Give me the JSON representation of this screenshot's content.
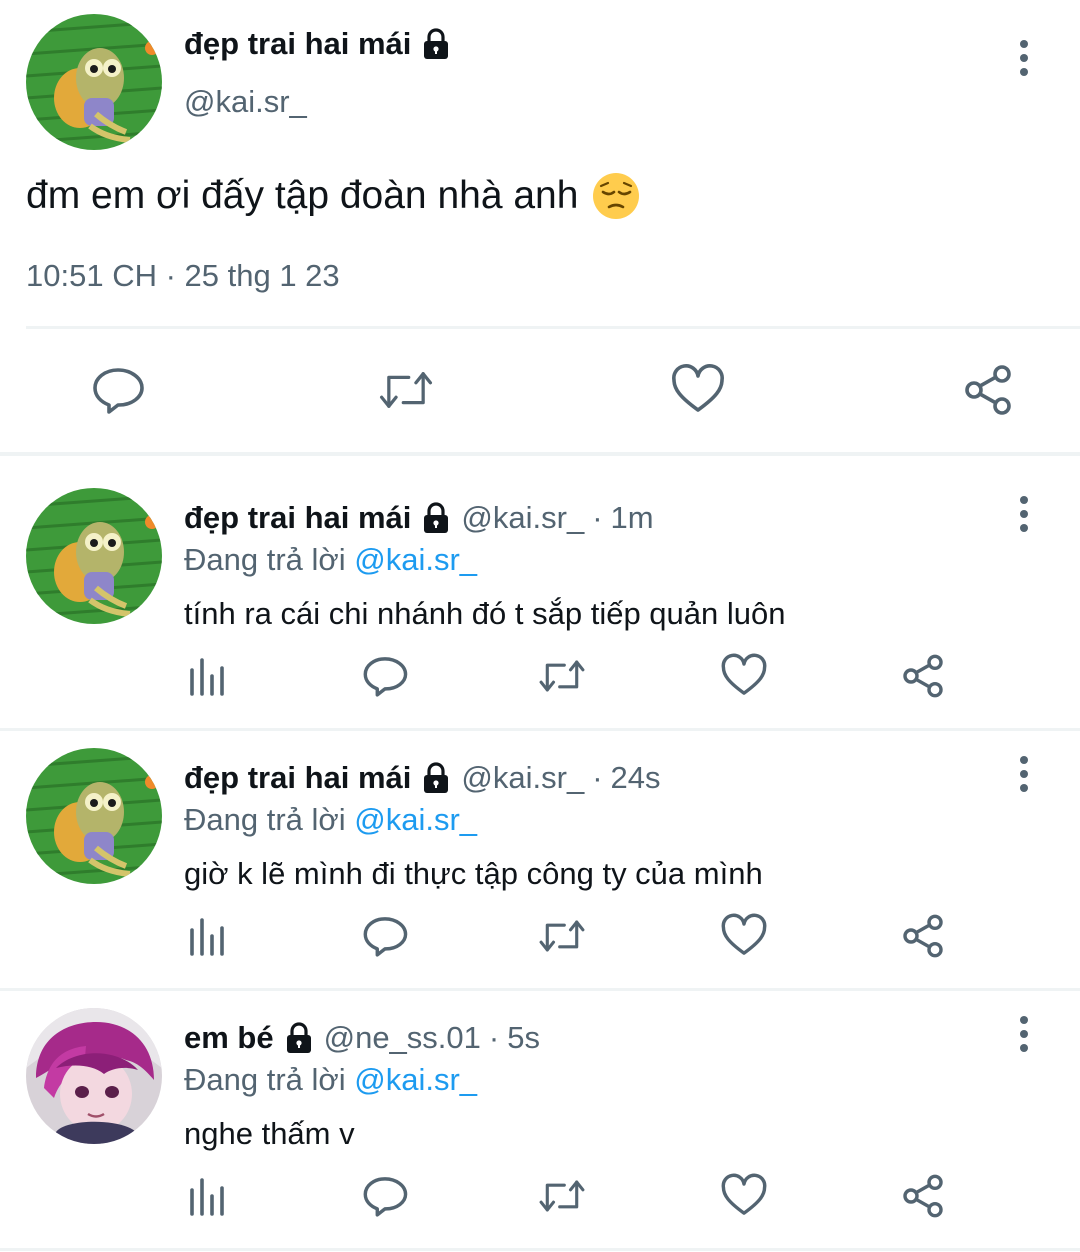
{
  "main_tweet": {
    "name": "đẹp trai hai mái",
    "handle": "@kai.sr_",
    "text": "đm em ơi đấy tập đoàn nhà anh",
    "emoji": "😔",
    "timestamp": "10:51 CH · 25 thg 1 23",
    "icons": [
      "reply-icon",
      "retweet-icon",
      "like-icon",
      "share-icon"
    ]
  },
  "replies": [
    {
      "name": "đẹp trai hai mái",
      "handle": "@kai.sr_",
      "dot": "·",
      "time": "1m",
      "replying_prefix": "Đang trả lời",
      "replying_to": "@kai.sr_",
      "text": "tính ra cái chi nhánh đó t sắp tiếp quản luôn"
    },
    {
      "name": "đẹp trai hai mái",
      "handle": "@kai.sr_",
      "dot": "·",
      "time": "24s",
      "replying_prefix": "Đang trả lời",
      "replying_to": "@kai.sr_",
      "text": "giờ k lẽ mình đi thực tập công ty của mình"
    },
    {
      "name": "em bé",
      "handle": "@ne_ss.01",
      "dot": "·",
      "time": "5s",
      "replying_prefix": "Đang trả lời",
      "replying_to": "@kai.sr_",
      "text": "nghe thấm v"
    }
  ],
  "colors": {
    "text": "#0f1419",
    "secondary": "#536471",
    "mention": "#1d9bf0",
    "divider": "#eff3f4"
  }
}
